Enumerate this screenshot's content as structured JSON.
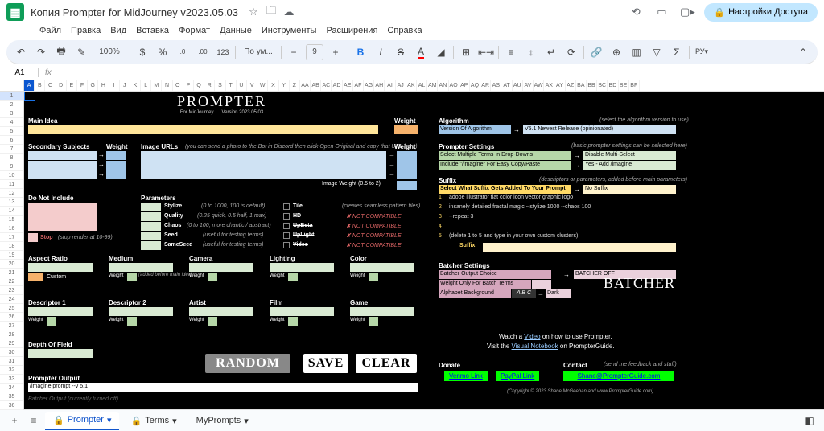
{
  "header": {
    "title": "Копия Prompter for MidJourney v2023.05.03",
    "menu": [
      "Файл",
      "Правка",
      "Вид",
      "Вставка",
      "Формат",
      "Данные",
      "Инструменты",
      "Расширения",
      "Справка"
    ],
    "share": "Настройки Доступа",
    "zoom": "100%",
    "font": "По ум...",
    "fontsize": "9",
    "currency": "$",
    "percent": "%",
    "dec1": ".0",
    "dec2": ".00",
    "moref": "123"
  },
  "cellref": "A1",
  "cols": [
    "A",
    "B",
    "C",
    "D",
    "E",
    "F",
    "G",
    "H",
    "I",
    "J",
    "K",
    "L",
    "M",
    "N",
    "O",
    "P",
    "Q",
    "R",
    "S",
    "T",
    "U",
    "V",
    "W",
    "X",
    "Y",
    "Z",
    "AA",
    "AB",
    "AC",
    "AD",
    "AE",
    "AF",
    "AG",
    "AH",
    "AI",
    "AJ",
    "AK",
    "AL",
    "AM",
    "AN",
    "AO",
    "AP",
    "AQ",
    "AR",
    "AS",
    "AT",
    "AU",
    "AV",
    "AW",
    "AX",
    "AY",
    "AZ",
    "BA",
    "BB",
    "BC",
    "BD",
    "BE",
    "BF"
  ],
  "logo": {
    "title": "PROMPTER",
    "sub1": "For MidJourney",
    "sub2": "Version  2023.05.03"
  },
  "labels": {
    "mainidea": "Main Idea",
    "weight": "Weight",
    "secondary": "Secondary Subjects",
    "imageurls": "Image URLs",
    "imageurls_hint": "(you can send a photo to the Bot in Discord then click Open Original and copy that URL here)",
    "imageweight": "Image Weight (0.5 to 2)",
    "notinclude": "Do Not Include",
    "parameters": "Parameters",
    "stylize": "Stylize",
    "quality": "Quality",
    "chaos": "Chaos",
    "seed": "Seed",
    "sameseed": "SameSeed",
    "stylize_h": "(0 to 1000, 100 is default)",
    "quality_h": "(0.25 quick, 0.5 half, 1 max)",
    "chaos_h": "(0 to 100, more chaotic / abstract)",
    "seed_h": "(useful for testing terms)",
    "sameseed_h": "(useful for testing terms)",
    "tile": "Tile",
    "hd": "HD",
    "upbeta": "UpBeta",
    "uplight": "UpLight",
    "video": "Video",
    "tile_h": "(creates seamless pattern tiles)",
    "notcompat": "NOT COMPATIBLE",
    "stop": "Stop",
    "stop_h": "(stop render at 10-99)",
    "aspect": "Aspect Ratio",
    "medium": "Medium",
    "medium_h": "(added before main idea)",
    "camera": "Camera",
    "lighting": "Lighting",
    "color": "Color",
    "custom": "Custom",
    "desc1": "Descriptor 1",
    "desc2": "Descriptor 2",
    "artist": "Artist",
    "film": "Film",
    "game": "Game",
    "dof": "Depth Of Field",
    "prompter_output": "Prompter Output",
    "output_val": "/imagine prompt --v 5.1",
    "random": "RANDOM",
    "save": "SAVE",
    "clear": "CLEAR",
    "algo": "Algorithm",
    "algo_h": "(select the algorithm version to use)",
    "algo_lbl": "Version Of Algorithm",
    "algo_val": "V5.1 Newest Release (opinionated)",
    "psettings": "Prompter Settings",
    "psettings_h": "(basic prompter settings can be selected here)",
    "ps1": "Select Multiple Terms In Drop-Downs",
    "ps1v": "Disable Multi-Select",
    "ps2": "Include \"/imagine\" For Easy Copy/Paste",
    "ps2v": "Yes - Add /imagine",
    "suffix": "Suffix",
    "suffix_h": "(descriptors or parameters, added before main parameters)",
    "suffix_lbl": "Select What Suffix Gets Added To Your Prompt",
    "suffix_val": "No Suffix",
    "s1": "adobe illustrator flat color icon vector graphic logo",
    "s2": "insanely detailed fractal magic --stylize 1000 --chaos 100",
    "s3": "--repeat 3",
    "s5": "(delete 1 to 5 and type in your own custom clusters)",
    "suffix_b": "Suffix",
    "batcher": "Batcher Settings",
    "boc": "Batcher Output Choice",
    "bocv": "BATCHER OFF",
    "wob": "Weight Only For Batch Terms",
    "ab": "Alphabet Background",
    "abv": "A B C",
    "dark": "Dark",
    "batcher_logo": "BATCHER",
    "watch": "Watch a ",
    "video_l": "Video",
    "watch2": " on how to use Prompter.",
    "visit": "Visit the ",
    "vn": "Visual Notebook",
    "visit2": " on PrompterGuide.",
    "donate": "Donate",
    "venmo": "Venmo Link",
    "paypal": "PayPal Link",
    "contact": "Contact",
    "contact_h": "(send me feedback and stuff)",
    "email": "Shane@PrompterGuide.com",
    "copyright": "(Copyright © 2023 Shane McGeehan and www.PrompterGuide.com)",
    "batcher_off": "Batcher Output (currently turned off)"
  },
  "tabs": {
    "t1": "Prompter",
    "t2": "Terms",
    "t3": "MyPrompts"
  }
}
